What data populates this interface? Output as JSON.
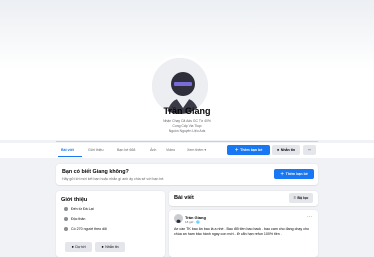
{
  "profile": {
    "name": "Trần Giang",
    "bio_lines": [
      "Nhận Chạy Cã Ads GC Từ 40%",
      "Cung Cấp Via Tkqc",
      "Nguồn Nguyên Liệu Ads"
    ]
  },
  "tabs": [
    {
      "label": "Bài viết",
      "active": true
    },
    {
      "label": "Giới thiệu"
    },
    {
      "label": "Bạn bè",
      "count": "668"
    },
    {
      "label": "Ảnh"
    },
    {
      "label": "Video"
    },
    {
      "label": "Xem thêm ▾"
    }
  ],
  "actions": {
    "add_friend": "Thêm bạn bè",
    "message": "Nhắn tin",
    "more": "···"
  },
  "suggest": {
    "title": "Bạn có biết Giang không?",
    "subtitle": "Hãy gửi lời mời kết bạn hoặc nhắn gì anh ấy chia sẻ với bạn bè.",
    "button": "Thêm bạn bè"
  },
  "intro": {
    "title": "Giới thiệu",
    "items": [
      {
        "icon": "location-icon",
        "text": "Đến từ Đà Lạt"
      },
      {
        "icon": "heart-icon",
        "text": "Độc thân"
      },
      {
        "icon": "followers-icon",
        "text": "Có 270 người theo dõi"
      }
    ],
    "chips": [
      {
        "icon": "phone-icon",
        "text": "Dự tới"
      },
      {
        "icon": "chat-icon",
        "text": "Nhắn tin"
      }
    ]
  },
  "posts": {
    "title": "Bài viết",
    "filter": "Bộ lọc",
    "item": {
      "author": "Trần Giang",
      "meta": "18 giờ · 🌐",
      "text": "Ae cần TK bao ăn bao là a nhé . Bao đổi tiền bao back . bao cam cho đang chạy cho chùa an ham bảo hành ngay con mới - lỡ cẩn hạn refun 100% tiền ."
    }
  },
  "colors": {
    "accent": "#1877f2",
    "background": "#f0f2f5",
    "secondary_button": "#e4e6eb"
  }
}
